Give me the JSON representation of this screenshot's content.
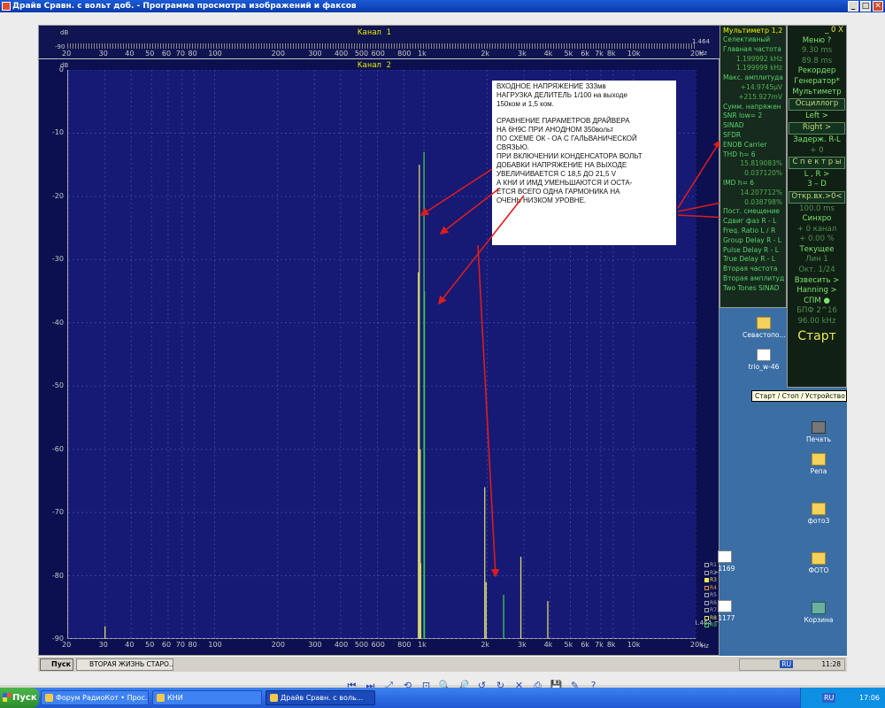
{
  "viewer": {
    "title": "Драйв Сравн.  с вольт доб. - Программа просмотра изображений и факсов"
  },
  "channel1": {
    "label": "Канал  1",
    "db_unit": "dB",
    "db_value": "-90",
    "right_value": "1.464",
    "freq_unit": "Hz"
  },
  "channel2": {
    "label": "Канал  2",
    "db_unit": "dB",
    "right_top": "1.464",
    "right_unit": "Hz"
  },
  "freq_ticks": [
    "20",
    "30",
    "40",
    "50",
    "60",
    "70",
    "80",
    "100",
    "200",
    "300",
    "400",
    "500",
    "600",
    "800",
    "1k",
    "2k",
    "3k",
    "4k",
    "5k",
    "6k",
    "7k",
    "8k",
    "10k",
    "20k"
  ],
  "chart_data": {
    "type": "line",
    "xscale": "log",
    "xlim": [
      20,
      20000
    ],
    "ylim": [
      -90,
      0
    ],
    "y_ticks": [
      0,
      -10,
      -20,
      -30,
      -40,
      -50,
      -60,
      -70,
      -80,
      -90
    ],
    "x_ticks": [
      20,
      30,
      40,
      50,
      60,
      70,
      80,
      100,
      200,
      300,
      400,
      500,
      600,
      800,
      1000,
      2000,
      3000,
      4000,
      5000,
      6000,
      7000,
      8000,
      10000,
      20000
    ],
    "x_tick_labels": [
      "20",
      "30",
      "40",
      "50",
      "60",
      "70",
      "80",
      "100",
      "200",
      "300",
      "400",
      "500",
      "600",
      "800",
      "1k",
      "2k",
      "3k",
      "4k",
      "5k",
      "6k",
      "7k",
      "8k",
      "10k",
      "20k"
    ],
    "grid": true,
    "series": [
      {
        "color": "#d8d870",
        "peaks": [
          {
            "x": 950,
            "y": -15
          },
          {
            "x": 940,
            "y": -32
          },
          {
            "x": 960,
            "y": -60
          },
          {
            "x": 965,
            "y": -78
          },
          {
            "x": 1950,
            "y": -66
          },
          {
            "x": 1980,
            "y": -81
          },
          {
            "x": 2900,
            "y": -77
          },
          {
            "x": 3900,
            "y": -84
          },
          {
            "x": 30,
            "y": -88
          }
        ]
      },
      {
        "color": "#3dcc4c",
        "peaks": [
          {
            "x": 1000,
            "y": -13
          },
          {
            "x": 1005,
            "y": -35
          },
          {
            "x": 2400,
            "y": -83
          }
        ]
      }
    ]
  },
  "annotation": {
    "para1": "ВХОДНОЕ НАПРЯЖЕНИЕ 333мв\nНАГРУЗКА ДЕЛИТЕЛЬ 1/100 на выходе\n 150ком и 1,5 ком.",
    "para2": "СРАВНЕНИЕ ПАРАМЕТРОВ ДРАЙВЕРА\nНА 6Н9С ПРИ АНОДНОМ 350вольт\nПО СХЕМЕ ОК - ОА С ГАЛЬВАНИЧЕСКОЙ\nСВЯЗЬЮ.\nПРИ ВКЛЮЧЕНИИ КОНДЕНСАТОРА ВОЛЬТ\nДОБАВКИ НАПРЯЖЕНИЕ НА ВЫХОДЕ\nУВЕЛИЧИВАЕТСЯ С 18,5 ДО 21,5 V\nА КНИ И ИМД УМЕНЬШАЮТСЯ И ОСТА-\nЁТСЯ ВСЕГО ОДНА ГАРМОНИКА НА\nОЧЕНЬ НИЗКОМ УРОВНЕ."
  },
  "legend": [
    "R1",
    "R2",
    "R3",
    "R4",
    "R5",
    "R6",
    "R7",
    "R8",
    "R9"
  ],
  "meter": {
    "head": "Мультиметр 1,2",
    "items": [
      {
        "t": "Селективный",
        "cls": ""
      },
      {
        "t": "Главная частота",
        "cls": ""
      },
      {
        "t": "1.199992 kHz",
        "cls": "val"
      },
      {
        "t": "1.199999 kHz",
        "cls": "val"
      },
      {
        "t": "Макс. амплитуда",
        "cls": ""
      },
      {
        "t": "+14.9745µV",
        "cls": "val"
      },
      {
        "t": "+215.927mV",
        "cls": "val"
      },
      {
        "t": "Сумм. напряжен",
        "cls": ""
      },
      {
        "t": "SNR    low= 2",
        "cls": ""
      },
      {
        "t": "SINAD",
        "cls": ""
      },
      {
        "t": "SFDR",
        "cls": ""
      },
      {
        "t": "ENOB  Carrier",
        "cls": ""
      },
      {
        "t": "THD      h=  6",
        "cls": ""
      },
      {
        "t": "15.819083%",
        "cls": "val"
      },
      {
        "t": "0.037120%",
        "cls": "val"
      },
      {
        "t": "IMD      h=  6",
        "cls": ""
      },
      {
        "t": "14.207712%",
        "cls": "val"
      },
      {
        "t": "0.038798%",
        "cls": "val"
      },
      {
        "t": "Пост. смещение",
        "cls": ""
      },
      {
        "t": "Сдвиг фаз R - L",
        "cls": ""
      },
      {
        "t": "Freq. Ratio  L / R",
        "cls": ""
      },
      {
        "t": "Group Delay R - L",
        "cls": ""
      },
      {
        "t": "Pulse Delay R - L",
        "cls": ""
      },
      {
        "t": "True Delay R - L",
        "cls": ""
      },
      {
        "t": "Вторая частота",
        "cls": ""
      },
      {
        "t": "Вторая амплитуд",
        "cls": ""
      },
      {
        "t": "Two Tones SINAD",
        "cls": ""
      }
    ]
  },
  "control": {
    "top_buttons": "_ 0 X",
    "rows": [
      {
        "t": "Меню        ?",
        "cls": ""
      },
      {
        "t": "9.30 ms",
        "cls": "dim"
      },
      {
        "t": "89.8 ms",
        "cls": "dim"
      },
      {
        "t": "Рекордер",
        "cls": ""
      },
      {
        "t": "Генератор*",
        "cls": ""
      },
      {
        "t": "Мультиметр",
        "cls": ""
      },
      {
        "t": "Осциллогр",
        "cls": "btn"
      },
      {
        "t": "Left     >",
        "cls": ""
      },
      {
        "t": "Right    >",
        "cls": "btn"
      },
      {
        "t": "Задерж. R-L",
        "cls": ""
      },
      {
        "t": "+      0",
        "cls": "dim"
      },
      {
        "t": "С п е к т р ы",
        "cls": "btn"
      },
      {
        "t": "L , R   >",
        "cls": ""
      },
      {
        "t": "3 – D",
        "cls": ""
      },
      {
        "t": "Откр.вх.>0<",
        "cls": "btn"
      },
      {
        "t": "100.0 ms",
        "cls": "dim"
      },
      {
        "t": "Синхро",
        "cls": ""
      },
      {
        "t": "+ 0 канал",
        "cls": "dim"
      },
      {
        "t": "+ 0.00 %",
        "cls": "dim"
      },
      {
        "t": "Текущее",
        "cls": ""
      },
      {
        "t": "Лин      1",
        "cls": "dim"
      },
      {
        "t": "Окт.  1/24",
        "cls": "dim"
      },
      {
        "t": "Взвесить  >",
        "cls": ""
      },
      {
        "t": "Hanning   >",
        "cls": ""
      },
      {
        "t": "СПМ       ●",
        "cls": ""
      },
      {
        "t": "БПФ  2^16",
        "cls": "dim"
      },
      {
        "t": "96.00 kHz",
        "cls": "dim"
      },
      {
        "t": "Старт",
        "cls": "big"
      }
    ]
  },
  "tooltip": "Старт / Стоп / Устройство",
  "desktop_icons": [
    {
      "label": "Севастопо...",
      "kind": ""
    },
    {
      "label": "trio_w-46",
      "kind": "doc"
    },
    {
      "label": "Печать",
      "kind": "print"
    },
    {
      "label": "Репа",
      "kind": ""
    },
    {
      "label": "фото3",
      "kind": ""
    },
    {
      "label": "ФОТО",
      "kind": ""
    },
    {
      "label": "Корзина",
      "kind": "bin"
    },
    {
      "label": "_1169",
      "kind": "doc"
    },
    {
      "label": "_1177",
      "kind": "doc"
    }
  ],
  "inner_taskbar": {
    "start": "Пуск",
    "task": "ВТОРАЯ ЖИЗНЬ СТАРО...",
    "lang": "RU",
    "time": "11:28"
  },
  "viewer_tools": [
    "⏮",
    "⏭",
    "⤢",
    "⟲",
    "⊡",
    "🔍",
    "🔎",
    "↺",
    "↻",
    "✕",
    "⎙",
    "💾",
    "✎",
    "?"
  ],
  "xp_taskbar": {
    "start": "Пуск",
    "tasks": [
      "Форум РадиоКот • Прос...",
      "КНИ",
      "Драйв Сравн.  с воль..."
    ],
    "lang": "RU",
    "time": "17:06"
  }
}
